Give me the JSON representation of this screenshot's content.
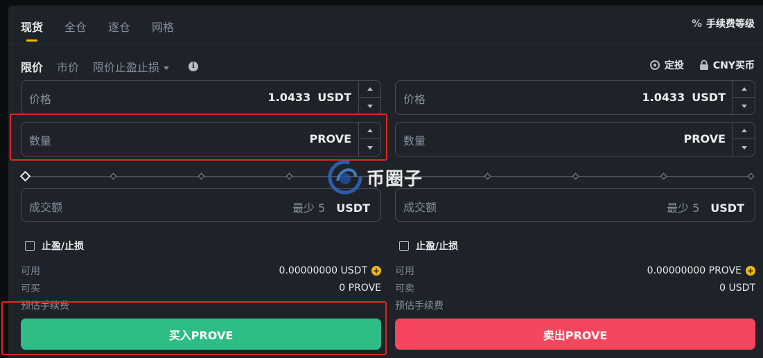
{
  "tabs": [
    "现货",
    "全仓",
    "逐仓",
    "网格"
  ],
  "fee_level": "手续费等级",
  "order_types": [
    "限价",
    "市价",
    "限价止盈止损"
  ],
  "right_links": {
    "auto_invest": "定投",
    "buy_crypto": "CNY买币"
  },
  "buy": {
    "price_label": "价格",
    "price_value": "1.0433",
    "price_unit": "USDT",
    "qty_label": "数量",
    "qty_unit": "PROVE",
    "total_label": "成交额",
    "total_min": "最少 5",
    "total_unit": "USDT",
    "tpsl_label": "止盈/止损",
    "available_label": "可用",
    "available_value": "0.00000000 USDT",
    "max_label": "可买",
    "max_value": "0 PROVE",
    "fee_label": "预估手续费",
    "button": "买入PROVE"
  },
  "sell": {
    "price_label": "价格",
    "price_value": "1.0433",
    "price_unit": "USDT",
    "qty_label": "数量",
    "qty_unit": "PROVE",
    "total_label": "成交额",
    "total_min": "最少 5",
    "total_unit": "USDT",
    "tpsl_label": "止盈/止损",
    "available_label": "可用",
    "available_value": "0.00000000 PROVE",
    "max_label": "可卖",
    "max_value": "0 USDT",
    "fee_label": "预估手续费",
    "button": "卖出PROVE"
  },
  "watermark": "币圈子",
  "colors": {
    "buy": "#2ebd85",
    "sell": "#f6465d",
    "accent": "#f0b90b",
    "highlight": "#e0271f"
  }
}
